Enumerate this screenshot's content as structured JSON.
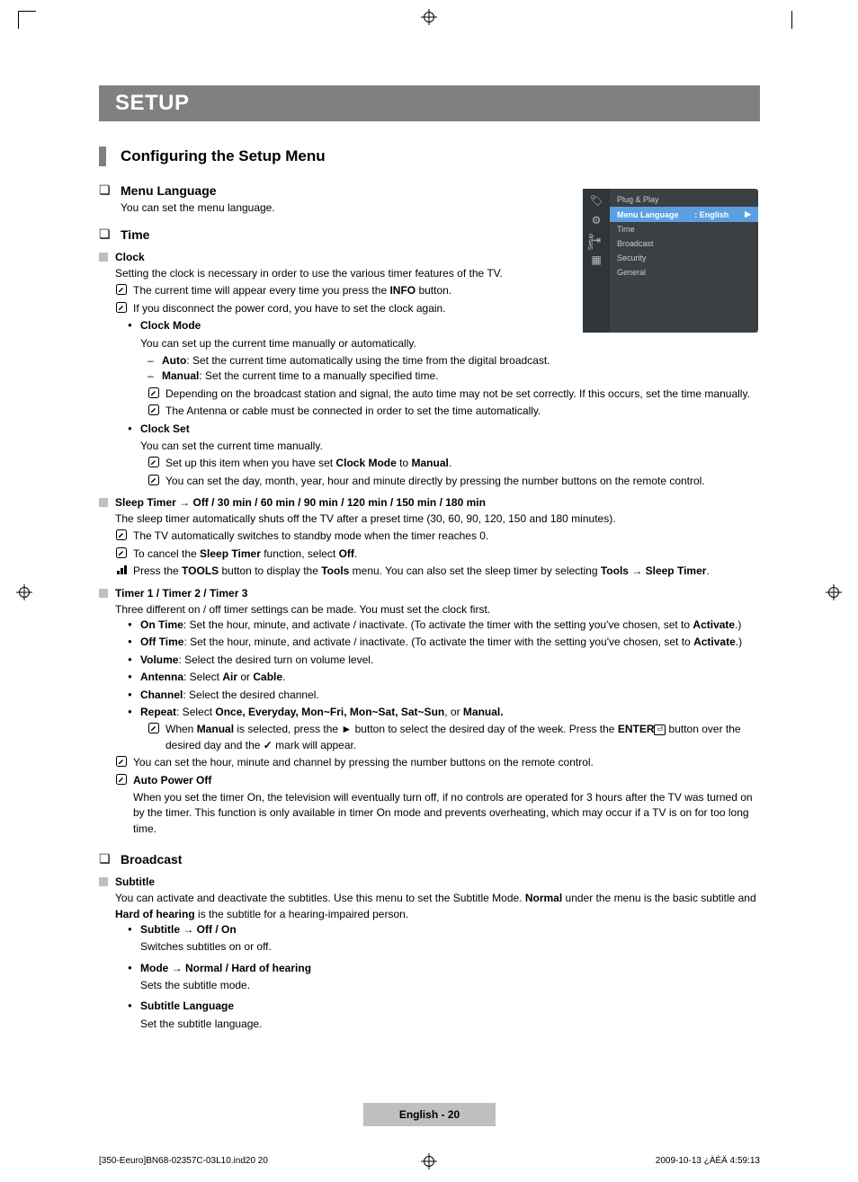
{
  "banner": "SETUP",
  "h2": "Configuring the Setup Menu",
  "osd": {
    "label": "Setup",
    "items": [
      {
        "label": "Plug & Play",
        "value": "",
        "sel": false
      },
      {
        "label": "Menu Language",
        "value": ": English",
        "sel": true
      },
      {
        "label": "Time",
        "value": "",
        "sel": false
      },
      {
        "label": "Broadcast",
        "value": "",
        "sel": false
      },
      {
        "label": "Security",
        "value": "",
        "sel": false
      },
      {
        "label": "General",
        "value": "",
        "sel": false
      }
    ]
  },
  "sec_ml": {
    "title": "Menu Language",
    "desc": "You can set the menu language."
  },
  "sec_time": {
    "title": "Time"
  },
  "clock": {
    "title": "Clock",
    "desc": "Setting the clock is necessary in order to use the various timer features of the TV.",
    "n1a": "The current time will appear every time you press the ",
    "n1b": "INFO",
    "n1c": " button.",
    "n2": "If you disconnect the power cord, you have to set the clock again."
  },
  "clock_mode": {
    "title": "Clock Mode",
    "desc": "You can set up the current time manually or automatically.",
    "d1a": "Auto",
    "d1b": ": Set the current time automatically using the time from the digital broadcast.",
    "d2a": "Manual",
    "d2b": ": Set the current time to a manually specified time.",
    "n1": "Depending on the broadcast station and signal, the auto time may not be set correctly. If this occurs, set the time manually.",
    "n2": "The Antenna or cable must be connected in order to set the time automatically."
  },
  "clock_set": {
    "title": "Clock Set",
    "desc": "You can set the current time manually.",
    "n1a": "Set up this item when you have set ",
    "n1b": "Clock Mode",
    "n1c": " to ",
    "n1d": "Manual",
    "n1e": ".",
    "n2": "You can set the day, month, year, hour and minute directly by pressing the number buttons on the remote control."
  },
  "sleep": {
    "title": "Sleep Timer → Off / 30 min / 60 min / 90 min / 120 min / 150 min / 180 min",
    "desc": "The sleep timer automatically shuts off the TV after a preset time (30, 60, 90, 120, 150 and 180 minutes).",
    "n1": "The TV automatically switches to standby mode when the timer reaches 0.",
    "n2a": "To cancel the ",
    "n2b": "Sleep Timer",
    "n2c": " function, select ",
    "n2d": "Off",
    "n2e": ".",
    "n3a": "Press the ",
    "n3b": "TOOLS",
    "n3c": " button to display the ",
    "n3d": "Tools",
    "n3e": " menu. You can also set the sleep timer by selecting ",
    "n3f": "Tools",
    "n3g": " → ",
    "n3h": "Sleep Timer",
    "n3i": "."
  },
  "timer": {
    "title": "Timer 1 / Timer 2 / Timer 3",
    "desc": "Three different on / off timer settings can be made. You must set the clock first.",
    "b1a": "On Time",
    "b1b": ": Set the hour, minute, and activate / inactivate. (To activate the timer with the setting you've chosen, set to ",
    "b1c": "Activate",
    "b1d": ".)",
    "b2a": "Off Time",
    "b2b": ": Set the hour, minute, and activate / inactivate. (To activate the timer with the setting you've chosen, set to ",
    "b2c": "Activate",
    "b2d": ".)",
    "b3a": "Volume",
    "b3b": ": Select the desired turn on volume level.",
    "b4a": "Antenna",
    "b4b": ": Select ",
    "b4c": "Air",
    "b4d": " or ",
    "b4e": "Cable",
    "b4f": ".",
    "b5a": "Channel",
    "b5b": ": Select the desired channel.",
    "b6a": "Repeat",
    "b6b": ": Select ",
    "b6c": "Once, Everyday, Mon~Fri, Mon~Sat, Sat~Sun",
    "b6d": ", or ",
    "b6e": "Manual.",
    "b6na": "When ",
    "b6nb": "Manual",
    "b6nc": " is selected, press the ► button to select the desired day of the week. Press the ",
    "b6nd": "ENTER",
    "b6ne": " button over the desired day and the ",
    "b6nf": " mark will appear.",
    "n1": "You can set the hour, minute and channel by pressing the number buttons on the remote control.",
    "apo_title": "Auto Power Off",
    "apo_desc": "When you set the timer On, the television will eventually turn off, if no controls are operated for 3 hours after the TV was turned on by the timer. This function is only available in timer On mode and prevents overheating, which may occur if a TV is on for too long time."
  },
  "sec_broadcast": {
    "title": "Broadcast"
  },
  "subtitle": {
    "title": "Subtitle",
    "desc1": "You can activate and deactivate the subtitles. Use this menu to set the Subtitle Mode. ",
    "desc2": "Normal",
    "desc3": " under the menu is the basic subtitle and ",
    "desc4": "Hard of hearing",
    "desc5": " is the subtitle for a hearing-impaired person.",
    "b1a": "Subtitle → Off / On",
    "b1b": "Switches subtitles on or off.",
    "b2a": "Mode → Normal / Hard of hearing",
    "b2b": "Sets the subtitle mode.",
    "b3a": "Subtitle Language",
    "b3b": "Set the subtitle language."
  },
  "page_pill": "English - 20",
  "footer_left": "[350-Eeuro]BN68-02357C-03L10.ind20   20",
  "footer_right": "2009-10-13   ¿ÀÈÄ 4:59:13"
}
